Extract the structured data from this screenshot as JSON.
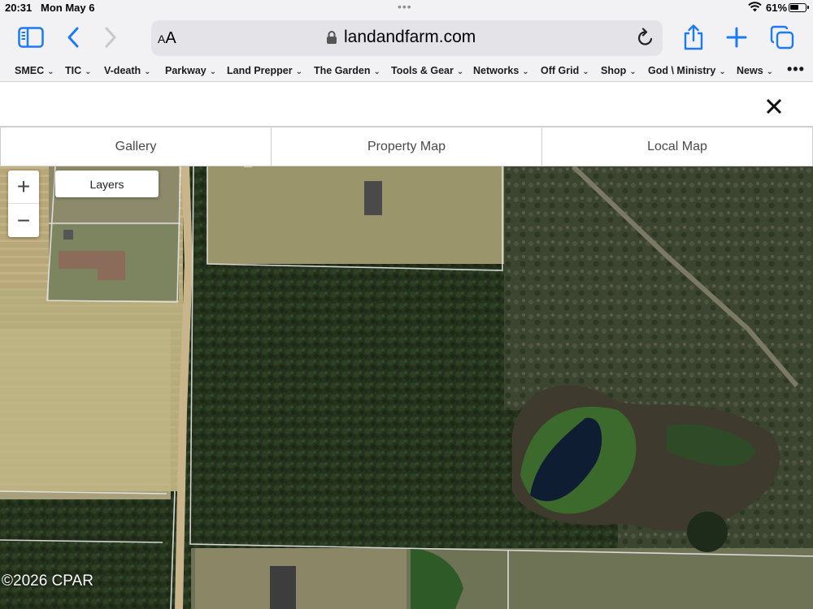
{
  "status": {
    "time": "20:31",
    "date": "Mon May 6",
    "battery_percent": "61%",
    "battery_level": 0.61
  },
  "toolbar": {
    "text_size_label": "AA",
    "url": "landandfarm.com",
    "icons": [
      "sidebar-icon",
      "back-icon",
      "forward-icon",
      "reload-icon",
      "share-icon",
      "plus-icon",
      "tabs-icon"
    ]
  },
  "bookmarks": [
    "SMEC",
    "TIC",
    "V-death",
    "Parkway",
    "Land Prepper",
    "The Garden",
    "Tools & Gear",
    "Networks",
    "Off Grid",
    "Shop",
    "God \\ Ministry",
    "News"
  ],
  "tabs": [
    "Gallery",
    "Property Map",
    "Local Map"
  ],
  "map": {
    "zoom_in": "+",
    "zoom_out": "−",
    "layers_label": "Layers",
    "copyright": "©2026 CPAR"
  },
  "colors": {
    "accent": "#1a7af8",
    "chrome": "#f2f2f4",
    "forest": "#24321c",
    "field": "#b9a876"
  }
}
